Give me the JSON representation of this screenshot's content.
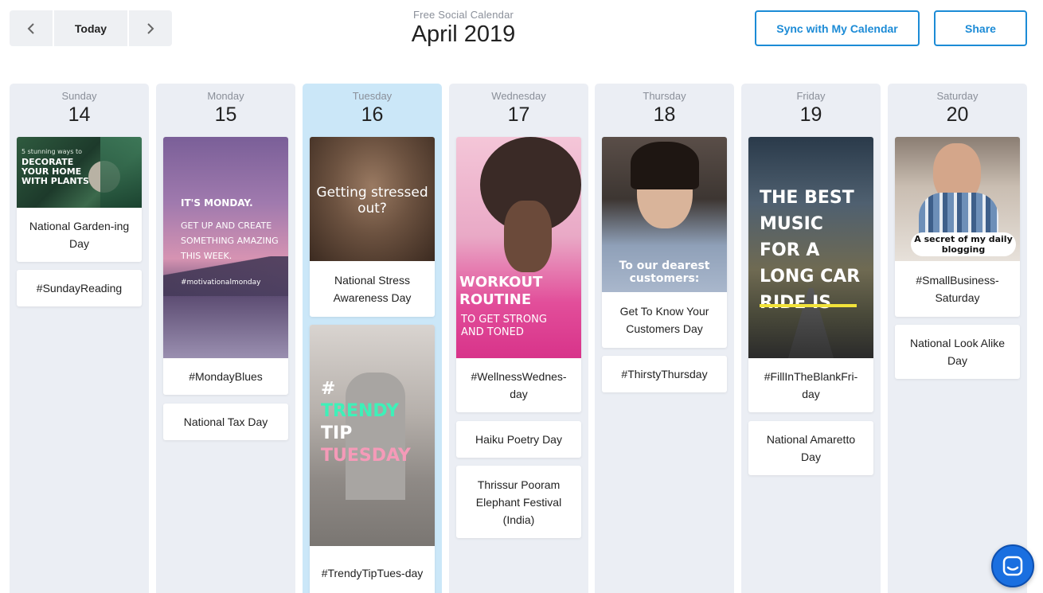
{
  "header": {
    "today_label": "Today",
    "subtitle": "Free Social Calendar",
    "month": "April 2019",
    "sync_label": "Sync with My Calendar",
    "share_label": "Share"
  },
  "colors": {
    "accent": "#1c8bd6",
    "column_bg": "#ebeef4",
    "today_bg": "#cbe7f8",
    "chat": "#1a6fe0"
  },
  "days": [
    {
      "name": "Sunday",
      "num": "14",
      "events": [
        {
          "label": "National Garden-ing Day",
          "image": {
            "line1": "5 stunning ways to",
            "line2": "DECORATE YOUR HOME WITH PLANTS"
          }
        },
        {
          "label": "#SundayReading"
        }
      ]
    },
    {
      "name": "Monday",
      "num": "15",
      "events": [
        {
          "label": "#MondayBlues",
          "image": {
            "line1": "IT'S MONDAY.",
            "line2": "GET UP AND CREATE SOMETHING AMAZING THIS WEEK.",
            "line3": "#motivationalmonday"
          }
        },
        {
          "label": "National Tax Day"
        }
      ]
    },
    {
      "name": "Tuesday",
      "num": "16",
      "events": [
        {
          "label": "National Stress Awareness Day",
          "image": {
            "line1": "Getting stressed out?"
          }
        },
        {
          "label": "#TrendyTipTues-day",
          "image": {
            "line1": "#",
            "line2": "TRENDY",
            "line3": "TIP",
            "line4": "TUESDAY"
          }
        }
      ]
    },
    {
      "name": "Wednesday",
      "num": "17",
      "events": [
        {
          "label": "#WellnessWednes-day",
          "image": {
            "line1": "WORKOUT ROUTINE",
            "line2": "TO GET STRONG AND TONED"
          }
        },
        {
          "label": "Haiku Poetry Day"
        },
        {
          "label": "Thrissur Pooram Elephant Festival (India)"
        }
      ]
    },
    {
      "name": "Thursday",
      "num": "18",
      "events": [
        {
          "label": "Get To Know Your Customers Day",
          "image": {
            "line1": "To our dearest customers:"
          }
        },
        {
          "label": "#ThirstyThursday"
        }
      ]
    },
    {
      "name": "Friday",
      "num": "19",
      "events": [
        {
          "label": "#FillInTheBlankFri-day",
          "image": {
            "line1": "THE BEST MUSIC FOR A LONG CAR RIDE IS"
          }
        },
        {
          "label": "National Amaretto Day"
        }
      ]
    },
    {
      "name": "Saturday",
      "num": "20",
      "events": [
        {
          "label": "#SmallBusiness-Saturday",
          "image": {
            "line1": "A secret of my daily blogging"
          }
        },
        {
          "label": "National Look Alike Day"
        }
      ]
    }
  ]
}
